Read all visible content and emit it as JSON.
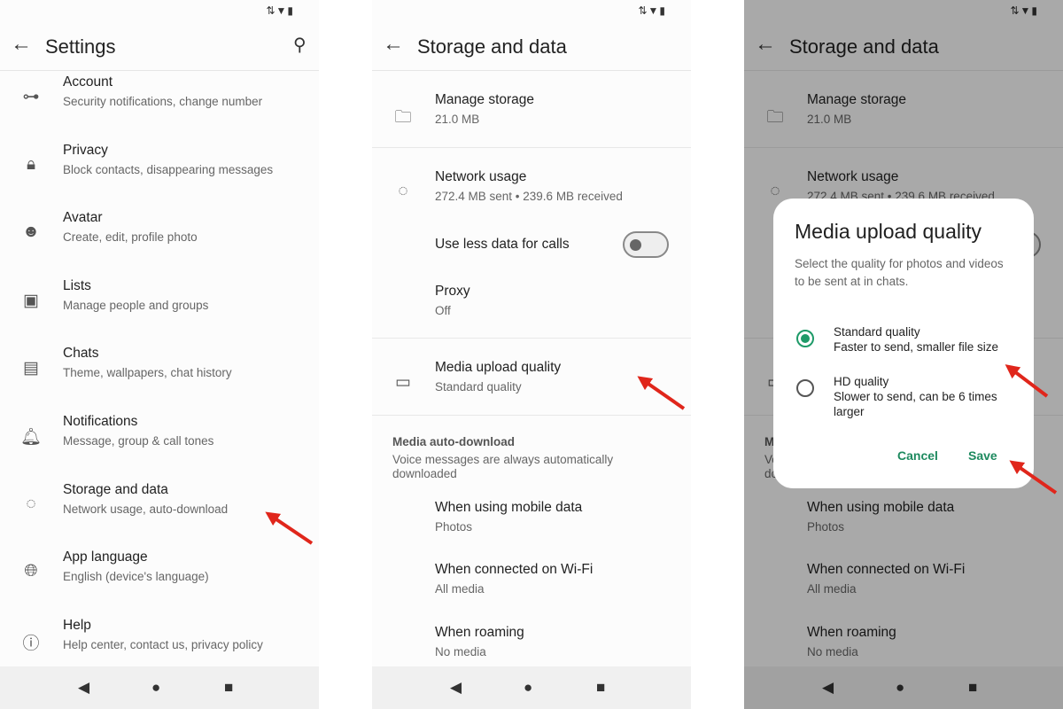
{
  "status_icons": "⇅▼▮",
  "settings": {
    "title": "Settings",
    "items": [
      {
        "title": "Account",
        "subtitle": "Security notifications, change number",
        "icon": "key-icon",
        "glyph": "⊶"
      },
      {
        "title": "Privacy",
        "subtitle": "Block contacts, disappearing messages",
        "icon": "lock-icon",
        "glyph": "🔒︎"
      },
      {
        "title": "Avatar",
        "subtitle": "Create, edit, profile photo",
        "icon": "avatar-icon",
        "glyph": "☻"
      },
      {
        "title": "Lists",
        "subtitle": "Manage people and groups",
        "icon": "lists-icon",
        "glyph": "▣"
      },
      {
        "title": "Chats",
        "subtitle": "Theme, wallpapers, chat history",
        "icon": "chat-icon",
        "glyph": "▤"
      },
      {
        "title": "Notifications",
        "subtitle": "Message, group & call tones",
        "icon": "bell-icon",
        "glyph": "🔔︎"
      },
      {
        "title": "Storage and data",
        "subtitle": "Network usage, auto-download",
        "icon": "storage-icon",
        "glyph": "◌"
      },
      {
        "title": "App language",
        "subtitle": "English (device's language)",
        "icon": "globe-icon",
        "glyph": "🌐︎"
      },
      {
        "title": "Help",
        "subtitle": "Help center, contact us, privacy policy",
        "icon": "help-icon",
        "glyph": "ⓘ"
      }
    ]
  },
  "storage": {
    "title": "Storage and data",
    "manage": {
      "title": "Manage storage",
      "subtitle": "21.0 MB"
    },
    "network": {
      "title": "Network usage",
      "subtitle": "272.4 MB sent • 239.6 MB received"
    },
    "less_data": {
      "title": "Use less data for calls",
      "enabled": false
    },
    "proxy": {
      "title": "Proxy",
      "subtitle": "Off"
    },
    "media": {
      "title": "Media upload quality",
      "subtitle": "Standard quality"
    },
    "auto_download": {
      "header": "Media auto-download",
      "desc": "Voice messages are always automatically downloaded"
    },
    "mobile": {
      "title": "When using mobile data",
      "subtitle": "Photos"
    },
    "wifi": {
      "title": "When connected on Wi-Fi",
      "subtitle": "All media"
    },
    "roaming": {
      "title": "When roaming",
      "subtitle": "No media"
    }
  },
  "dialog": {
    "title": "Media upload quality",
    "desc": "Select the quality for photos and videos to be sent at in chats.",
    "options": [
      {
        "title": "Standard quality",
        "subtitle": "Faster to send, smaller file size",
        "selected": true
      },
      {
        "title": "HD quality",
        "subtitle": "Slower to send, can be 6 times larger",
        "selected": false
      }
    ],
    "cancel": "Cancel",
    "save": "Save"
  },
  "colors": {
    "accent": "#1e9a68",
    "arrow": "#e0261b"
  }
}
